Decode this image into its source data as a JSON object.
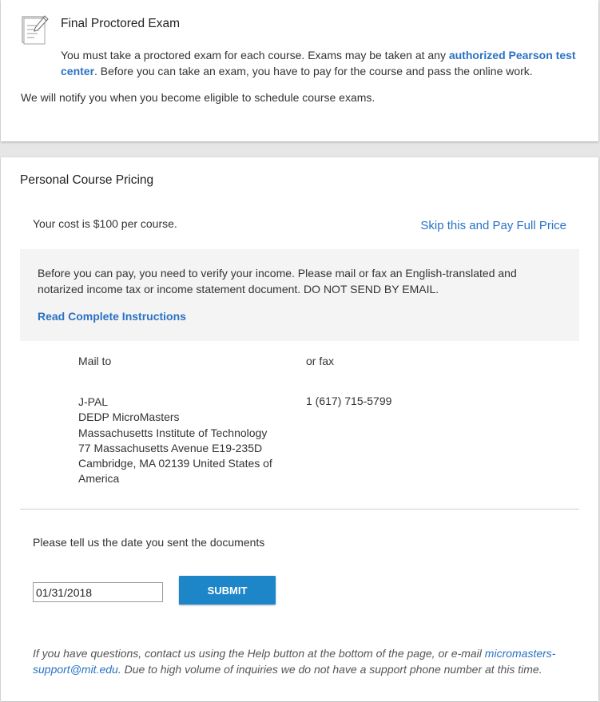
{
  "exam": {
    "title": "Final Proctored Exam",
    "desc_before": "You must take a proctored exam for each course. Exams may be taken at any ",
    "link_text": "authorized Pearson test center",
    "desc_after": ". Before you can take an exam, you have to pay for the course and pass the online work.",
    "notify": "We will notify you when you become eligible to schedule course exams.",
    "icon": "exam-paper-pencil-icon"
  },
  "pricing": {
    "title": "Personal Course Pricing",
    "cost": "Your cost is $100 per course.",
    "skip_link": "Skip this and Pay Full Price",
    "verify_text": "Before you can pay, you need to verify your income. Please mail or fax an English-translated and notarized income tax or income statement document. DO NOT SEND BY EMAIL.",
    "instructions_link": "Read Complete Instructions",
    "mail_label": "Mail to",
    "fax_label": "or fax",
    "address": {
      "line1": "J-PAL",
      "line2": "DEDP MicroMasters",
      "line3": "Massachusetts Institute of Technology",
      "line4": "77 Massachusetts Avenue E19-235D",
      "line5": "Cambridge, MA 02139 United States of America"
    },
    "fax_number": "1 (617) 715-5799",
    "date_prompt": "Please tell us the date you sent the documents",
    "date_value": "01/31/2018",
    "submit_label": "SUBMIT",
    "help_before": "If you have questions, contact us using the Help button at the bottom of the page, or e-mail ",
    "help_email": "micromasters-support@mit.edu",
    "help_after": ". Due to high volume of inquiries we do not have a support phone number at this time."
  },
  "colors": {
    "link": "#2a72c4",
    "button": "#1d86c8",
    "page_bg": "#e6e6e6",
    "panel_bg": "#f4f4f4"
  }
}
